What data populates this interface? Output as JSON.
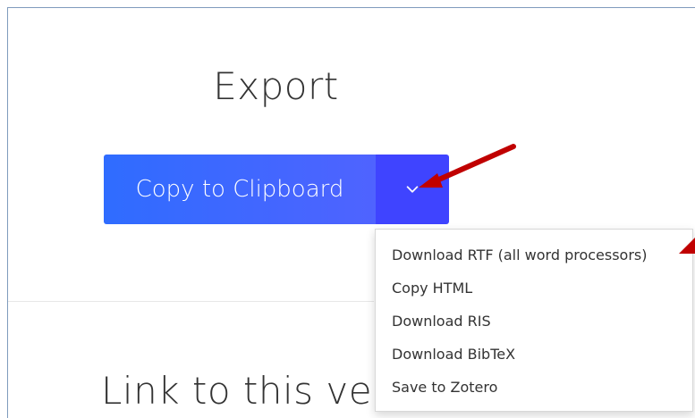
{
  "section": {
    "title": "Export"
  },
  "primary_action": {
    "label": "Copy to Clipboard"
  },
  "dropdown": {
    "toggle_icon": "chevron-down-icon",
    "items": [
      {
        "label": "Download RTF (all word processors)"
      },
      {
        "label": "Copy HTML"
      },
      {
        "label": "Download RIS"
      },
      {
        "label": "Download BibTeX"
      },
      {
        "label": "Save to Zotero"
      }
    ]
  },
  "next_section": {
    "title": "Link to this versi"
  },
  "annotations": {
    "arrow_color": "#c00000"
  },
  "colors": {
    "primary_button": "#2f6cff",
    "dropdown_button": "#3f44ff",
    "frame_border": "#7f9bbd"
  }
}
